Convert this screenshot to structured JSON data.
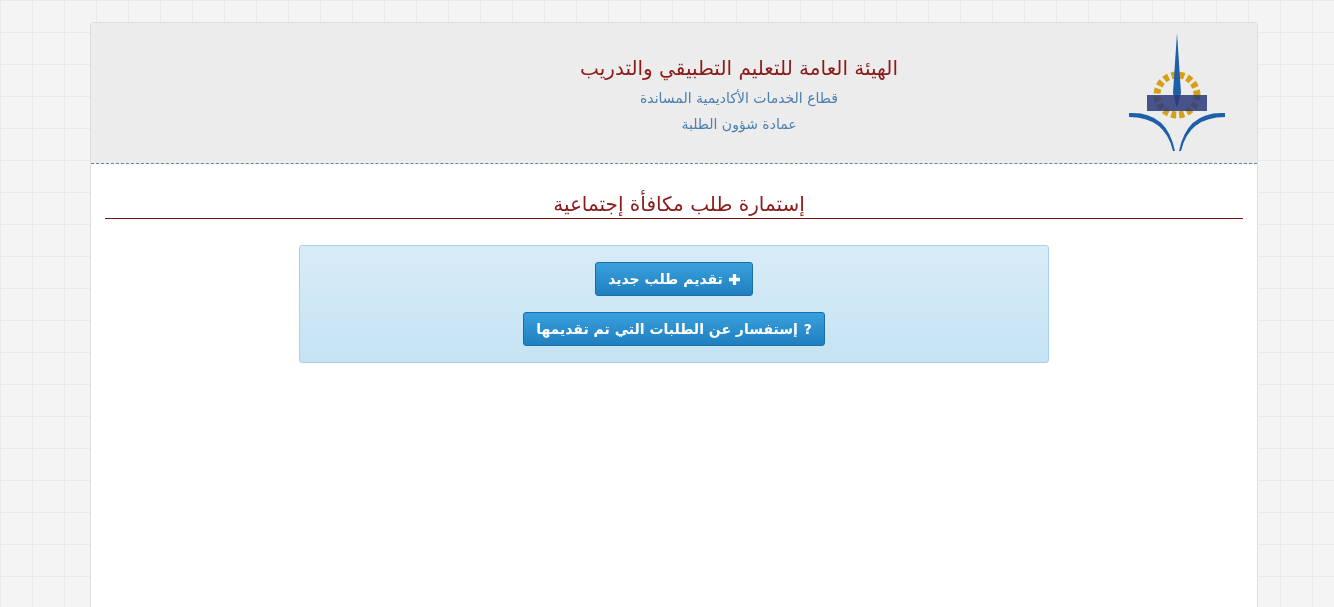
{
  "header": {
    "title": "الهيئة العامة للتعليم التطبيقي والتدريب",
    "subtitle": "قطاع الخدمات الأكاديمية المساندة",
    "department": "عمادة شؤون الطلبة"
  },
  "form_title": "إستمارة طلب مكافأة إجتماعية",
  "buttons": [
    {
      "kind": "add",
      "label": "تقديم طلب جديد"
    },
    {
      "kind": "query",
      "icon": "?",
      "label": "إستفسار عن الطلبات التي تم تقديمها"
    }
  ]
}
